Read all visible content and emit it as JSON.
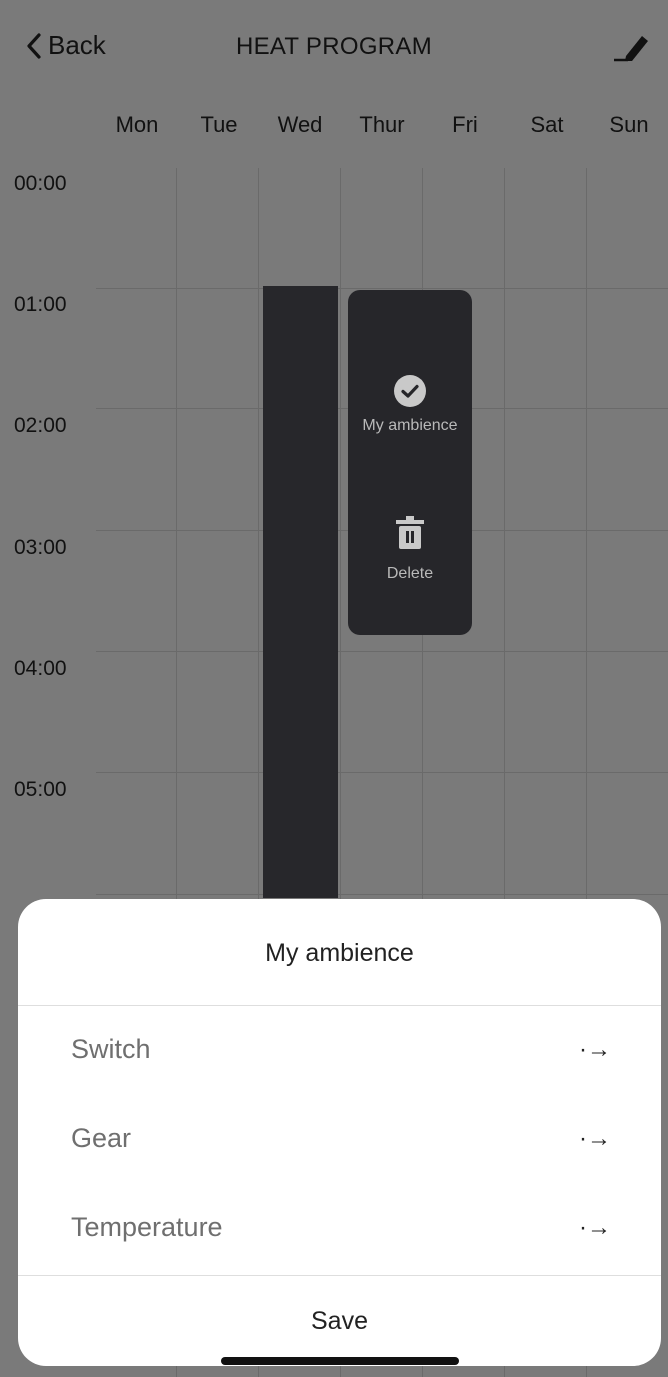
{
  "header": {
    "back_label": "Back",
    "title": "HEAT PROGRAM"
  },
  "days": [
    "Mon",
    "Tue",
    "Wed",
    "Thur",
    "Fri",
    "Sat",
    "Sun"
  ],
  "times": [
    "00:00",
    "01:00",
    "02:00",
    "03:00",
    "04:00",
    "05:00"
  ],
  "popup": {
    "ambience_label": "My ambience",
    "delete_label": "Delete"
  },
  "sheet": {
    "title": "My ambience",
    "rows": [
      {
        "label": "Switch",
        "arrow": "·→"
      },
      {
        "label": "Gear",
        "arrow": "·→"
      },
      {
        "label": "Temperature",
        "arrow": "·→"
      }
    ],
    "save_label": "Save"
  },
  "colors": {
    "overlay_bg": "#7a7a7a",
    "block": "#27272b",
    "sheet": "#ffffff"
  }
}
